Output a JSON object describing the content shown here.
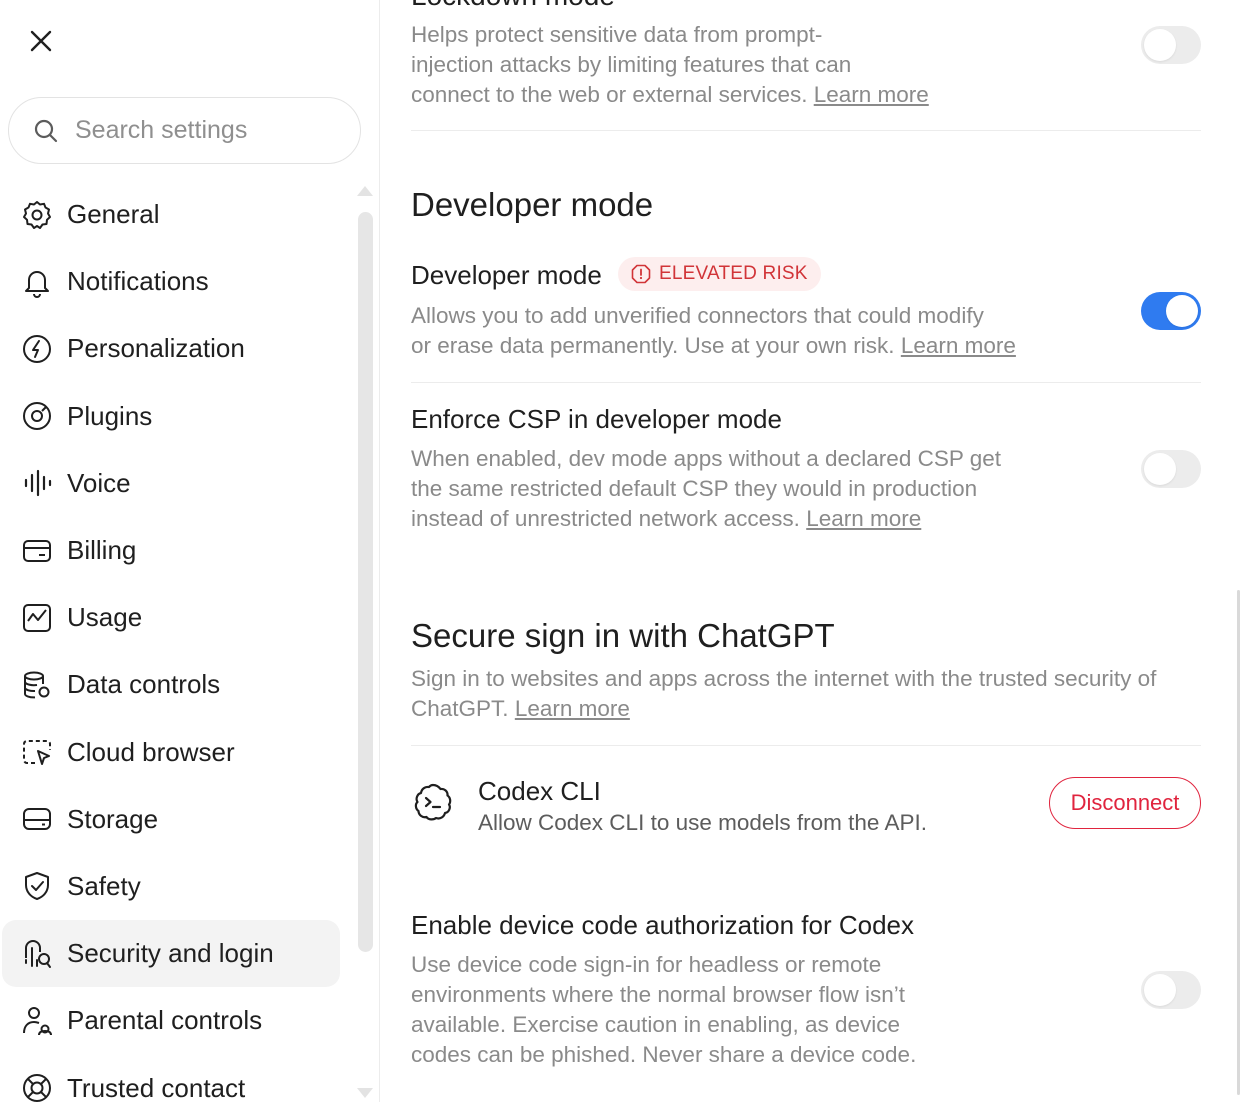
{
  "sidebar": {
    "search_placeholder": "Search settings",
    "items": [
      {
        "label": "General",
        "icon": "gear-icon"
      },
      {
        "label": "Notifications",
        "icon": "bell-icon"
      },
      {
        "label": "Personalization",
        "icon": "personalization-icon"
      },
      {
        "label": "Plugins",
        "icon": "plugins-icon"
      },
      {
        "label": "Voice",
        "icon": "waveform-icon"
      },
      {
        "label": "Billing",
        "icon": "card-icon"
      },
      {
        "label": "Usage",
        "icon": "chart-icon"
      },
      {
        "label": "Data controls",
        "icon": "database-icon"
      },
      {
        "label": "Cloud browser",
        "icon": "cloud-browser-icon"
      },
      {
        "label": "Storage",
        "icon": "storage-icon"
      },
      {
        "label": "Safety",
        "icon": "shield-icon"
      },
      {
        "label": "Security and login",
        "icon": "security-icon",
        "active": true
      },
      {
        "label": "Parental controls",
        "icon": "parental-icon"
      },
      {
        "label": "Trusted contact",
        "icon": "lifebuoy-icon"
      }
    ]
  },
  "main": {
    "lockdown": {
      "title_partial": "Lockdown mode",
      "description": "Helps protect sensitive data from prompt-injection attacks by limiting features that can connect to the web or external services.",
      "desc_line1": "Helps protect sensitive data from prompt-",
      "desc_line2": "injection attacks by limiting features that can",
      "desc_line3": "connect to the web or external services.",
      "link": "Learn more",
      "enabled": false
    },
    "developer_section_title": "Developer mode",
    "developer_mode": {
      "title": "Developer mode",
      "badge": "ELEVATED RISK",
      "desc_line1": "Allows you to add unverified connectors that could modify",
      "desc_line2": "or erase data permanently. Use at your own risk.",
      "link": "Learn more",
      "enabled": true
    },
    "enforce_csp": {
      "title": "Enforce CSP in developer mode",
      "desc_line1": "When enabled, dev mode apps without a declared CSP get",
      "desc_line2": "the same restricted default CSP they would in production",
      "desc_line3": "instead of unrestricted network access.",
      "link": "Learn more",
      "enabled": false
    },
    "secure_signin": {
      "title": "Secure sign in with ChatGPT",
      "desc_line1": "Sign in to websites and apps across the internet with the trusted security of",
      "desc_line2": "ChatGPT.",
      "link": "Learn more"
    },
    "codex_cli": {
      "title": "Codex CLI",
      "description": "Allow Codex CLI to use models from the API.",
      "button": "Disconnect"
    },
    "device_code": {
      "title": "Enable device code authorization for Codex",
      "desc_line1": "Use device code sign-in for headless or remote",
      "desc_line2": "environments where the normal browser flow isn’t",
      "desc_line3": "available. Exercise caution in enabling, as device",
      "desc_line4": "codes can be phished. Never share a device code.",
      "enabled": false
    }
  },
  "colors": {
    "accent": "#2f7bf0",
    "danger": "#e0243e",
    "badge_bg": "#fdeeee",
    "muted_text": "#8a8a8a"
  }
}
